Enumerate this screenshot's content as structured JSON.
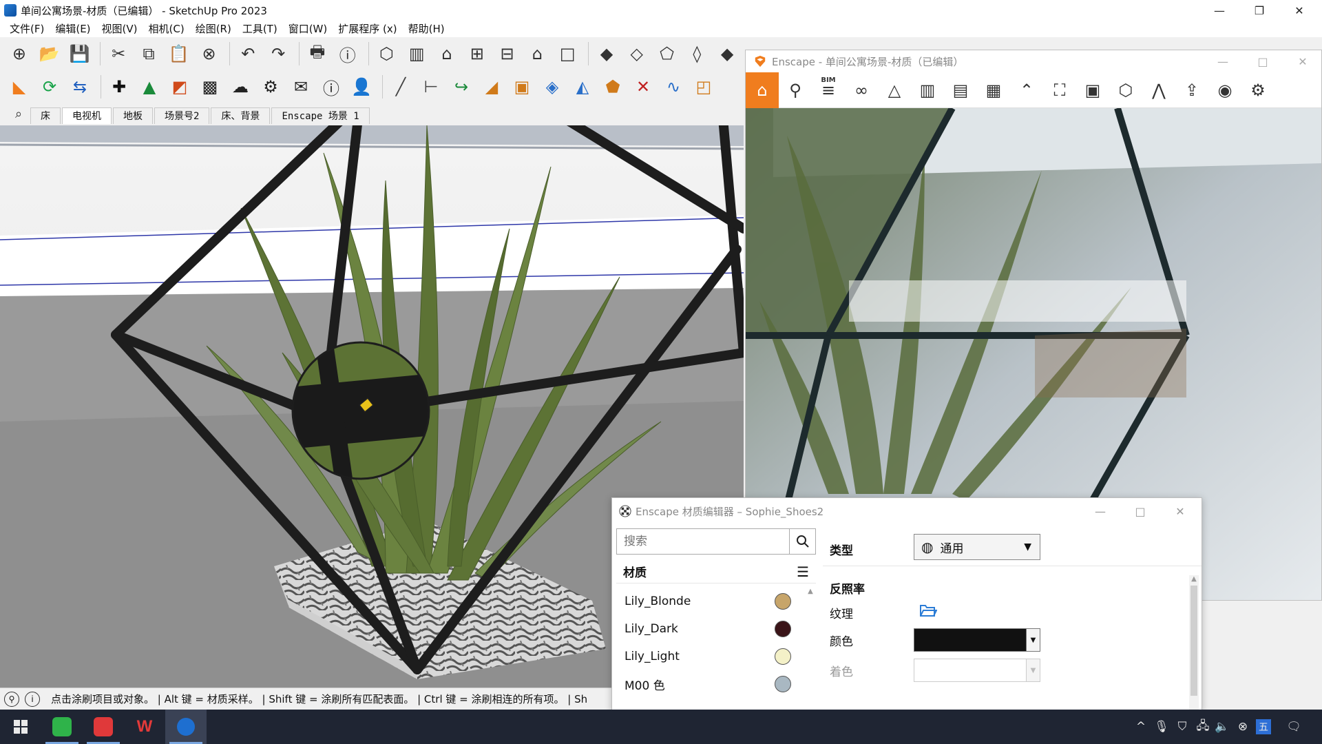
{
  "app": {
    "title": "单间公寓场景-材质（已编辑） - SketchUp Pro 2023",
    "window_controls": [
      "—",
      "❐",
      "✕"
    ]
  },
  "menu": [
    "文件(F)",
    "编辑(E)",
    "视图(V)",
    "相机(C)",
    "绘图(R)",
    "工具(T)",
    "窗口(W)",
    "扩展程序 (x)",
    "帮助(H)"
  ],
  "toolbar1": [
    {
      "icon": "new-icon",
      "glyph": "⊕"
    },
    {
      "icon": "open-icon",
      "glyph": "📂"
    },
    {
      "icon": "save-icon",
      "glyph": "💾"
    },
    {
      "icon": "cut-icon",
      "glyph": "✂"
    },
    {
      "icon": "copy-icon",
      "glyph": "⧉"
    },
    {
      "icon": "paste-icon",
      "glyph": "📋"
    },
    {
      "icon": "erase-icon",
      "glyph": "⊗"
    },
    {
      "icon": "undo-icon",
      "glyph": "↶"
    },
    {
      "icon": "redo-icon",
      "glyph": "↷"
    },
    {
      "icon": "print-icon",
      "glyph": "🖶"
    },
    {
      "icon": "model-info-icon",
      "glyph": "ⓘ"
    },
    {
      "icon": "iso-view-icon",
      "glyph": "⬡"
    },
    {
      "icon": "top-view-icon",
      "glyph": "▥"
    },
    {
      "icon": "front-view-icon",
      "glyph": "⌂"
    },
    {
      "icon": "right-view-icon",
      "glyph": "⊞"
    },
    {
      "icon": "back-view-icon",
      "glyph": "⊟"
    },
    {
      "icon": "left-view-icon",
      "glyph": "⌂"
    },
    {
      "icon": "bottom-view-icon",
      "glyph": "□"
    },
    {
      "icon": "xray-icon",
      "glyph": "◆"
    },
    {
      "icon": "backedges-icon",
      "glyph": "◇"
    },
    {
      "icon": "wireframe-icon",
      "glyph": "⬠"
    },
    {
      "icon": "hiddenline-icon",
      "glyph": "◊"
    },
    {
      "icon": "shaded-icon",
      "glyph": "◆"
    }
  ],
  "toolbar2": [
    {
      "icon": "enscape-start-icon",
      "glyph": "◣",
      "color": "#f07d1e"
    },
    {
      "icon": "enscape-sync-icon",
      "glyph": "⟳",
      "color": "#1aa34a"
    },
    {
      "icon": "enscape-sync-views-icon",
      "glyph": "⇆",
      "color": "#1f5fbf"
    },
    {
      "icon": "add-icon",
      "glyph": "✚",
      "color": "#111"
    },
    {
      "icon": "tree-icon",
      "glyph": "▲",
      "color": "#1a8a3a"
    },
    {
      "icon": "chart-icon",
      "glyph": "◩",
      "color": "#d04a1a"
    },
    {
      "icon": "checker-icon",
      "glyph": "▩",
      "color": "#222"
    },
    {
      "icon": "upload-icon",
      "glyph": "☁",
      "color": "#222"
    },
    {
      "icon": "settings-icon",
      "glyph": "⚙",
      "color": "#222"
    },
    {
      "icon": "mail-icon",
      "glyph": "✉",
      "color": "#222"
    },
    {
      "icon": "info-icon",
      "glyph": "ⓘ",
      "color": "#222"
    },
    {
      "icon": "user-icon",
      "glyph": "👤",
      "color": "#222"
    },
    {
      "icon": "line-icon",
      "glyph": "╱",
      "color": "#444"
    },
    {
      "icon": "dimension-icon",
      "glyph": "⊢",
      "color": "#444"
    },
    {
      "icon": "follow-me-icon",
      "glyph": "↪",
      "color": "#1a8a3a"
    },
    {
      "icon": "paint-bucket-icon",
      "glyph": "◢",
      "color": "#d07a1a"
    },
    {
      "icon": "material-icon",
      "glyph": "▣",
      "color": "#d07a1a"
    },
    {
      "icon": "pushpull-icon",
      "glyph": "◈",
      "color": "#2a6fc9"
    },
    {
      "icon": "move-icon",
      "glyph": "◭",
      "color": "#2a6fc9"
    },
    {
      "icon": "tag-icon",
      "glyph": "⬟",
      "color": "#d07a1a"
    },
    {
      "icon": "intersect-icon",
      "glyph": "✕",
      "color": "#c02020"
    },
    {
      "icon": "curve-icon",
      "glyph": "∿",
      "color": "#2a6fc9"
    },
    {
      "icon": "section-icon",
      "glyph": "◰",
      "color": "#d07a1a"
    }
  ],
  "scene_tabs": [
    "床",
    "电视机",
    "地板",
    "场景号2",
    "床、背景",
    "Enscape 场景 1"
  ],
  "active_scene_tab": "电视机",
  "status_text": "点击涂刷项目或对象。 | Alt 键 = 材质采样。 | Shift 键 = 涂刷所有匹配表面。 | Ctrl 键 = 涂刷相连的所有项。 | Sh",
  "enscape": {
    "title": "Enscape - 单间公寓场景-材质（已编辑）",
    "toolbar": [
      {
        "icon": "home-icon",
        "glyph": "⌂"
      },
      {
        "icon": "location-icon",
        "glyph": "⚲"
      },
      {
        "icon": "bim-icon",
        "glyph": "≡",
        "label": "BIM"
      },
      {
        "icon": "binoculars-icon",
        "glyph": "∞"
      },
      {
        "icon": "visual-settings-icon",
        "glyph": "△"
      },
      {
        "icon": "buildings-icon",
        "glyph": "▥"
      },
      {
        "icon": "clapper-icon",
        "glyph": "▤"
      },
      {
        "icon": "render-icon",
        "glyph": "▦"
      },
      {
        "icon": "chevron-up-icon",
        "glyph": "⌃"
      },
      {
        "icon": "map-icon",
        "glyph": "⛶"
      },
      {
        "icon": "panorama-icon",
        "glyph": "▣"
      },
      {
        "icon": "cube-icon",
        "glyph": "⬡"
      },
      {
        "icon": "vr-icon",
        "glyph": "⋀"
      },
      {
        "icon": "export-icon",
        "glyph": "⇪"
      },
      {
        "icon": "eye-icon",
        "glyph": "◉"
      },
      {
        "icon": "gear-icon",
        "glyph": "⚙"
      }
    ]
  },
  "material_editor": {
    "title": "Enscape 材质编辑器 – Sophie_Shoes2",
    "search_placeholder": "搜索",
    "list_header": "材质",
    "materials": [
      {
        "name": "Lily_Blonde",
        "color": "#c7a56a"
      },
      {
        "name": "Lily_Dark",
        "color": "#3a1418"
      },
      {
        "name": "Lily_Light",
        "color": "#f4f1c8"
      },
      {
        "name": "M00 色",
        "color": "#a9b8c2"
      }
    ],
    "type_label": "类型",
    "type_value": "通用",
    "section_albedo": "反照率",
    "texture_label": "纹理",
    "color_label": "颜色",
    "color_value": "#111111",
    "tint_label": "着色"
  },
  "taskbar": {
    "apps": [
      {
        "icon": "windows-start-icon"
      },
      {
        "icon": "camtasia-icon"
      },
      {
        "icon": "camtasia-recorder-icon"
      },
      {
        "icon": "wps-icon"
      },
      {
        "icon": "sketchup-icon"
      }
    ],
    "tray": [
      {
        "icon": "tray-chevron-icon",
        "glyph": "^"
      },
      {
        "icon": "microphone-icon",
        "glyph": "🎙"
      },
      {
        "icon": "shield-icon",
        "glyph": "⛉"
      },
      {
        "icon": "network-icon",
        "glyph": "🖧"
      },
      {
        "icon": "volume-icon",
        "glyph": "🔈"
      },
      {
        "icon": "close-circle-icon",
        "glyph": "⊗"
      },
      {
        "icon": "ime-icon",
        "glyph": "五"
      },
      {
        "icon": "notification-icon",
        "glyph": "🗨"
      }
    ]
  }
}
